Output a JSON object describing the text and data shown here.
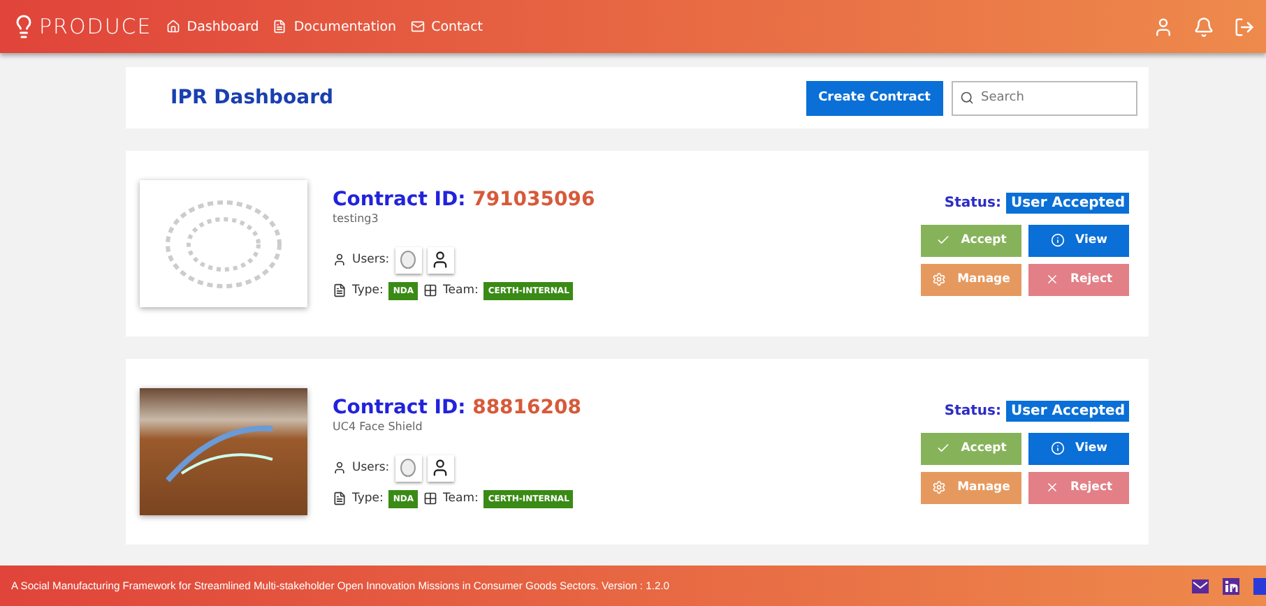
{
  "header": {
    "logo": "PRODUCE",
    "nav": [
      {
        "label": "Dashboard"
      },
      {
        "label": "Documentation"
      },
      {
        "label": "Contact"
      }
    ]
  },
  "dashboard": {
    "title": "IPR Dashboard",
    "create_button": "Create Contract",
    "search": {
      "placeholder": "Search"
    }
  },
  "contracts": [
    {
      "id_label": "Contract ID:",
      "id": "791035096",
      "name": "testing3",
      "users_label": "Users:",
      "type_label": "Type:",
      "type": "NDA",
      "team_label": "Team:",
      "team": "CERTH-INTERNAL",
      "status_label": "Status:",
      "status": "User Accepted",
      "actions": [
        "Accept",
        "View",
        "Manage",
        "Reject"
      ]
    },
    {
      "id_label": "Contract ID:",
      "id": "88816208",
      "name": "UC4 Face Shield",
      "users_label": "Users:",
      "type_label": "Type:",
      "type": "NDA",
      "team_label": "Team:",
      "team": "CERTH-INTERNAL",
      "status_label": "Status:",
      "status": "User Accepted",
      "actions": [
        "Accept",
        "View",
        "Manage",
        "Reject"
      ]
    }
  ],
  "footer": {
    "text": "A Social Manufacturing Framework for Streamlined Multi-stakeholder Open Innovation Missions in Consumer Goods Sectors. Version : 1.2.0"
  }
}
